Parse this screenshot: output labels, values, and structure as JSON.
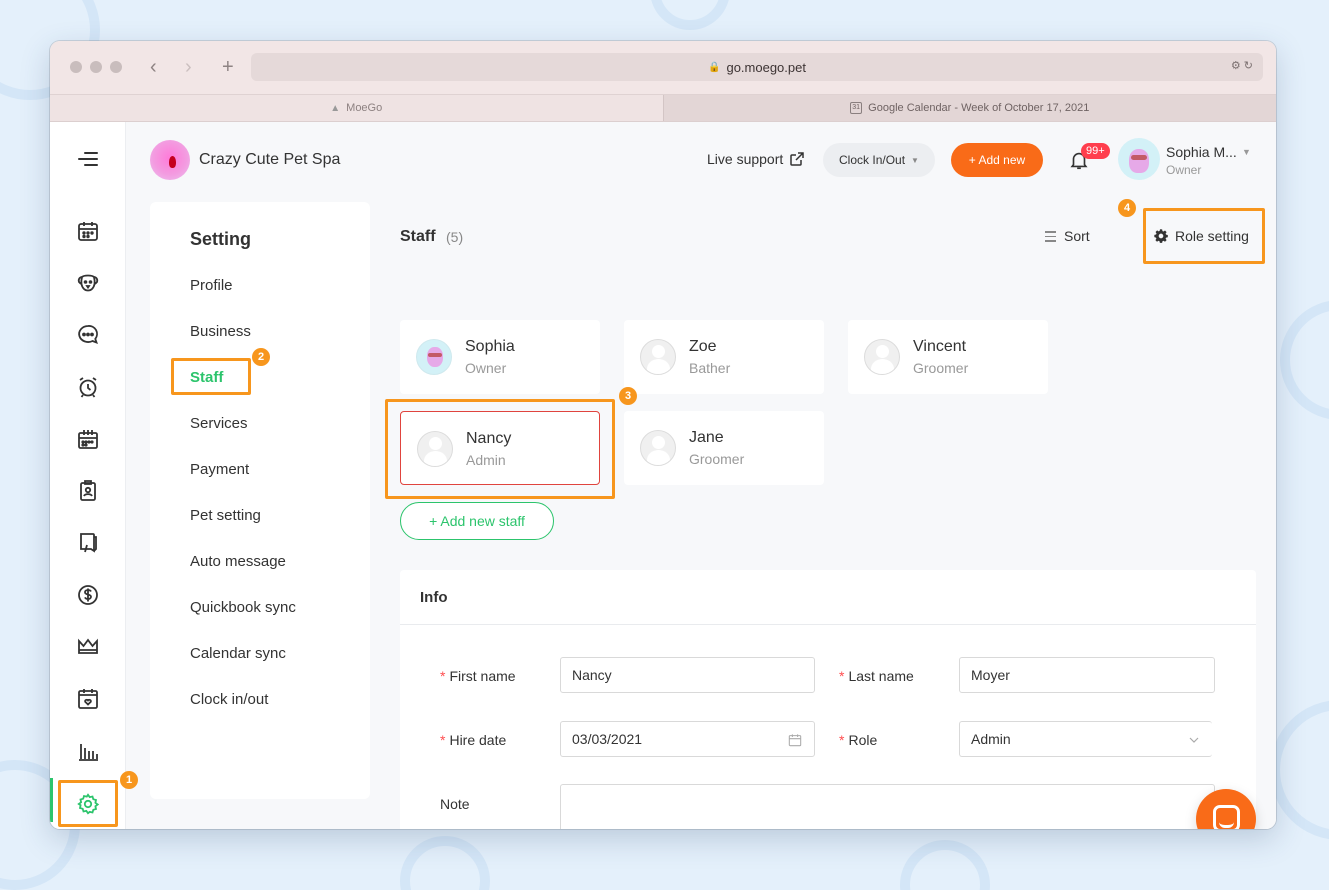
{
  "browser": {
    "url": "go.moego.pet",
    "tabs": [
      {
        "label": "MoeGo"
      },
      {
        "label": "Google Calendar - Week of October 17, 2021"
      }
    ]
  },
  "header": {
    "business_name": "Crazy Cute Pet Spa",
    "live_support": "Live support",
    "clock_button": "Clock In/Out",
    "add_new": "+ Add new",
    "notification_count": "99+",
    "user_name": "Sophia M...",
    "user_role": "Owner"
  },
  "setting_menu": {
    "title": "Setting",
    "items": [
      "Profile",
      "Business",
      "Staff",
      "Services",
      "Payment",
      "Pet setting",
      "Auto message",
      "Quickbook sync",
      "Calendar sync",
      "Clock in/out"
    ],
    "active": "Staff"
  },
  "staff": {
    "title": "Staff",
    "count": "(5)",
    "sort_label": "Sort",
    "role_setting_label": "Role setting",
    "members": [
      {
        "name": "Sophia",
        "role": "Owner"
      },
      {
        "name": "Zoe",
        "role": "Bather"
      },
      {
        "name": "Vincent",
        "role": "Groomer"
      },
      {
        "name": "Nancy",
        "role": "Admin"
      },
      {
        "name": "Jane",
        "role": "Groomer"
      }
    ],
    "add_button": "+ Add new staff"
  },
  "info": {
    "title": "Info",
    "first_name_label": "First name",
    "first_name_value": "Nancy",
    "last_name_label": "Last name",
    "last_name_value": "Moyer",
    "hire_date_label": "Hire date",
    "hire_date_value": "03/03/2021",
    "role_label": "Role",
    "role_value": "Admin",
    "note_label": "Note",
    "note_value": ""
  },
  "annotations": [
    "1",
    "2",
    "3",
    "4"
  ],
  "colors": {
    "accent_green": "#2cc46c",
    "brand_orange": "#f96b18",
    "highlight_orange": "#f7961d",
    "selected_red": "#e0443e",
    "badge_red": "#ff3e4d"
  },
  "icons": {
    "nav": [
      "menu-icon",
      "calendar-icon",
      "dog-icon",
      "chat-icon",
      "alarm-clock-icon",
      "schedule-icon",
      "badge-icon",
      "book-icon",
      "dollar-icon",
      "crown-icon",
      "card-icon",
      "bar-chart-icon",
      "gear-icon"
    ]
  }
}
